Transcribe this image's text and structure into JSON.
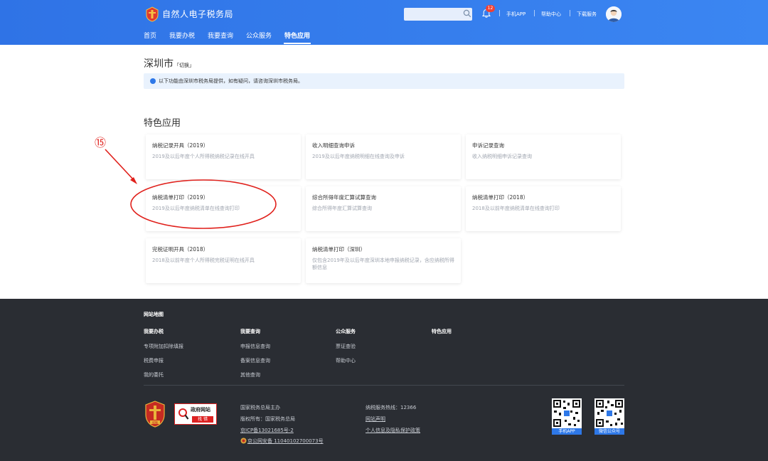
{
  "header": {
    "site_title": "自然人电子税务局",
    "search": {
      "placeholder": ""
    },
    "badge_count": "12",
    "links": [
      "手机APP",
      "帮助中心",
      "下载服务"
    ],
    "nav": [
      "首页",
      "我要办税",
      "我要查询",
      "公众服务",
      "特色应用"
    ],
    "active_nav": "特色应用",
    "brand_color": "#3179eb"
  },
  "main": {
    "city": "深圳市",
    "city_switch": "「切换」",
    "notice": "以下功能由深圳市税务局提供，如有疑问，请咨询深圳市税务局。",
    "section_title": "特色应用",
    "cards": [
      {
        "title": "纳税记录开具（2019）",
        "desc": "2019及以后年度个人所得税纳税记录在线开具"
      },
      {
        "title": "收入明细查询申诉",
        "desc": "2019及以后年度纳税明细在线查询及申诉"
      },
      {
        "title": "申诉记录查询",
        "desc": "收入纳税明细申诉记录查询"
      },
      {
        "title": "纳税清单打印（2019）",
        "desc": "2019及以后年度纳税清单在线查询打印"
      },
      {
        "title": "综合所得年度汇算试算查询",
        "desc": "综合所得年度汇算试算查询"
      },
      {
        "title": "纳税清单打印（2018）",
        "desc": "2018及以前年度纳税清单在线查询打印"
      },
      {
        "title": "完税证明开具（2018）",
        "desc": "2018及以前年度个人所得税完税证明在线开具"
      },
      {
        "title": "纳税清单打印（深圳）",
        "desc": "仅包含2019年及以后年度深圳本地申报纳税记录，含应纳税所得额信息"
      }
    ]
  },
  "annotation": {
    "marker": "⑮",
    "color": "#e0201b"
  },
  "footer": {
    "sitemap_title": "网站地图",
    "columns": [
      {
        "title": "我要办税",
        "items": [
          "专项附加扣除填报",
          "税费申报",
          "我的委托"
        ]
      },
      {
        "title": "我要查询",
        "items": [
          "申报信息查询",
          "备案信息查询",
          "其他查询"
        ]
      },
      {
        "title": "公众服务",
        "items": [
          "票证查验",
          "帮助中心"
        ]
      },
      {
        "title": "特色应用",
        "items": []
      }
    ],
    "emblem_label": "税徽",
    "gov_site_t1": "政府网站",
    "gov_site_t2": "找 错",
    "host": "国家税务总局主办",
    "copyright": "版权所有：国家税务总局",
    "icp": "京ICP备13021685号-2",
    "police": "京公网安备 11040102700073号",
    "hotline": "纳税服务热线：12366",
    "statement": "网站声明",
    "privacy": "个人信息及隐私保护政策",
    "qr": [
      "手机APP",
      "微信公众号"
    ]
  }
}
